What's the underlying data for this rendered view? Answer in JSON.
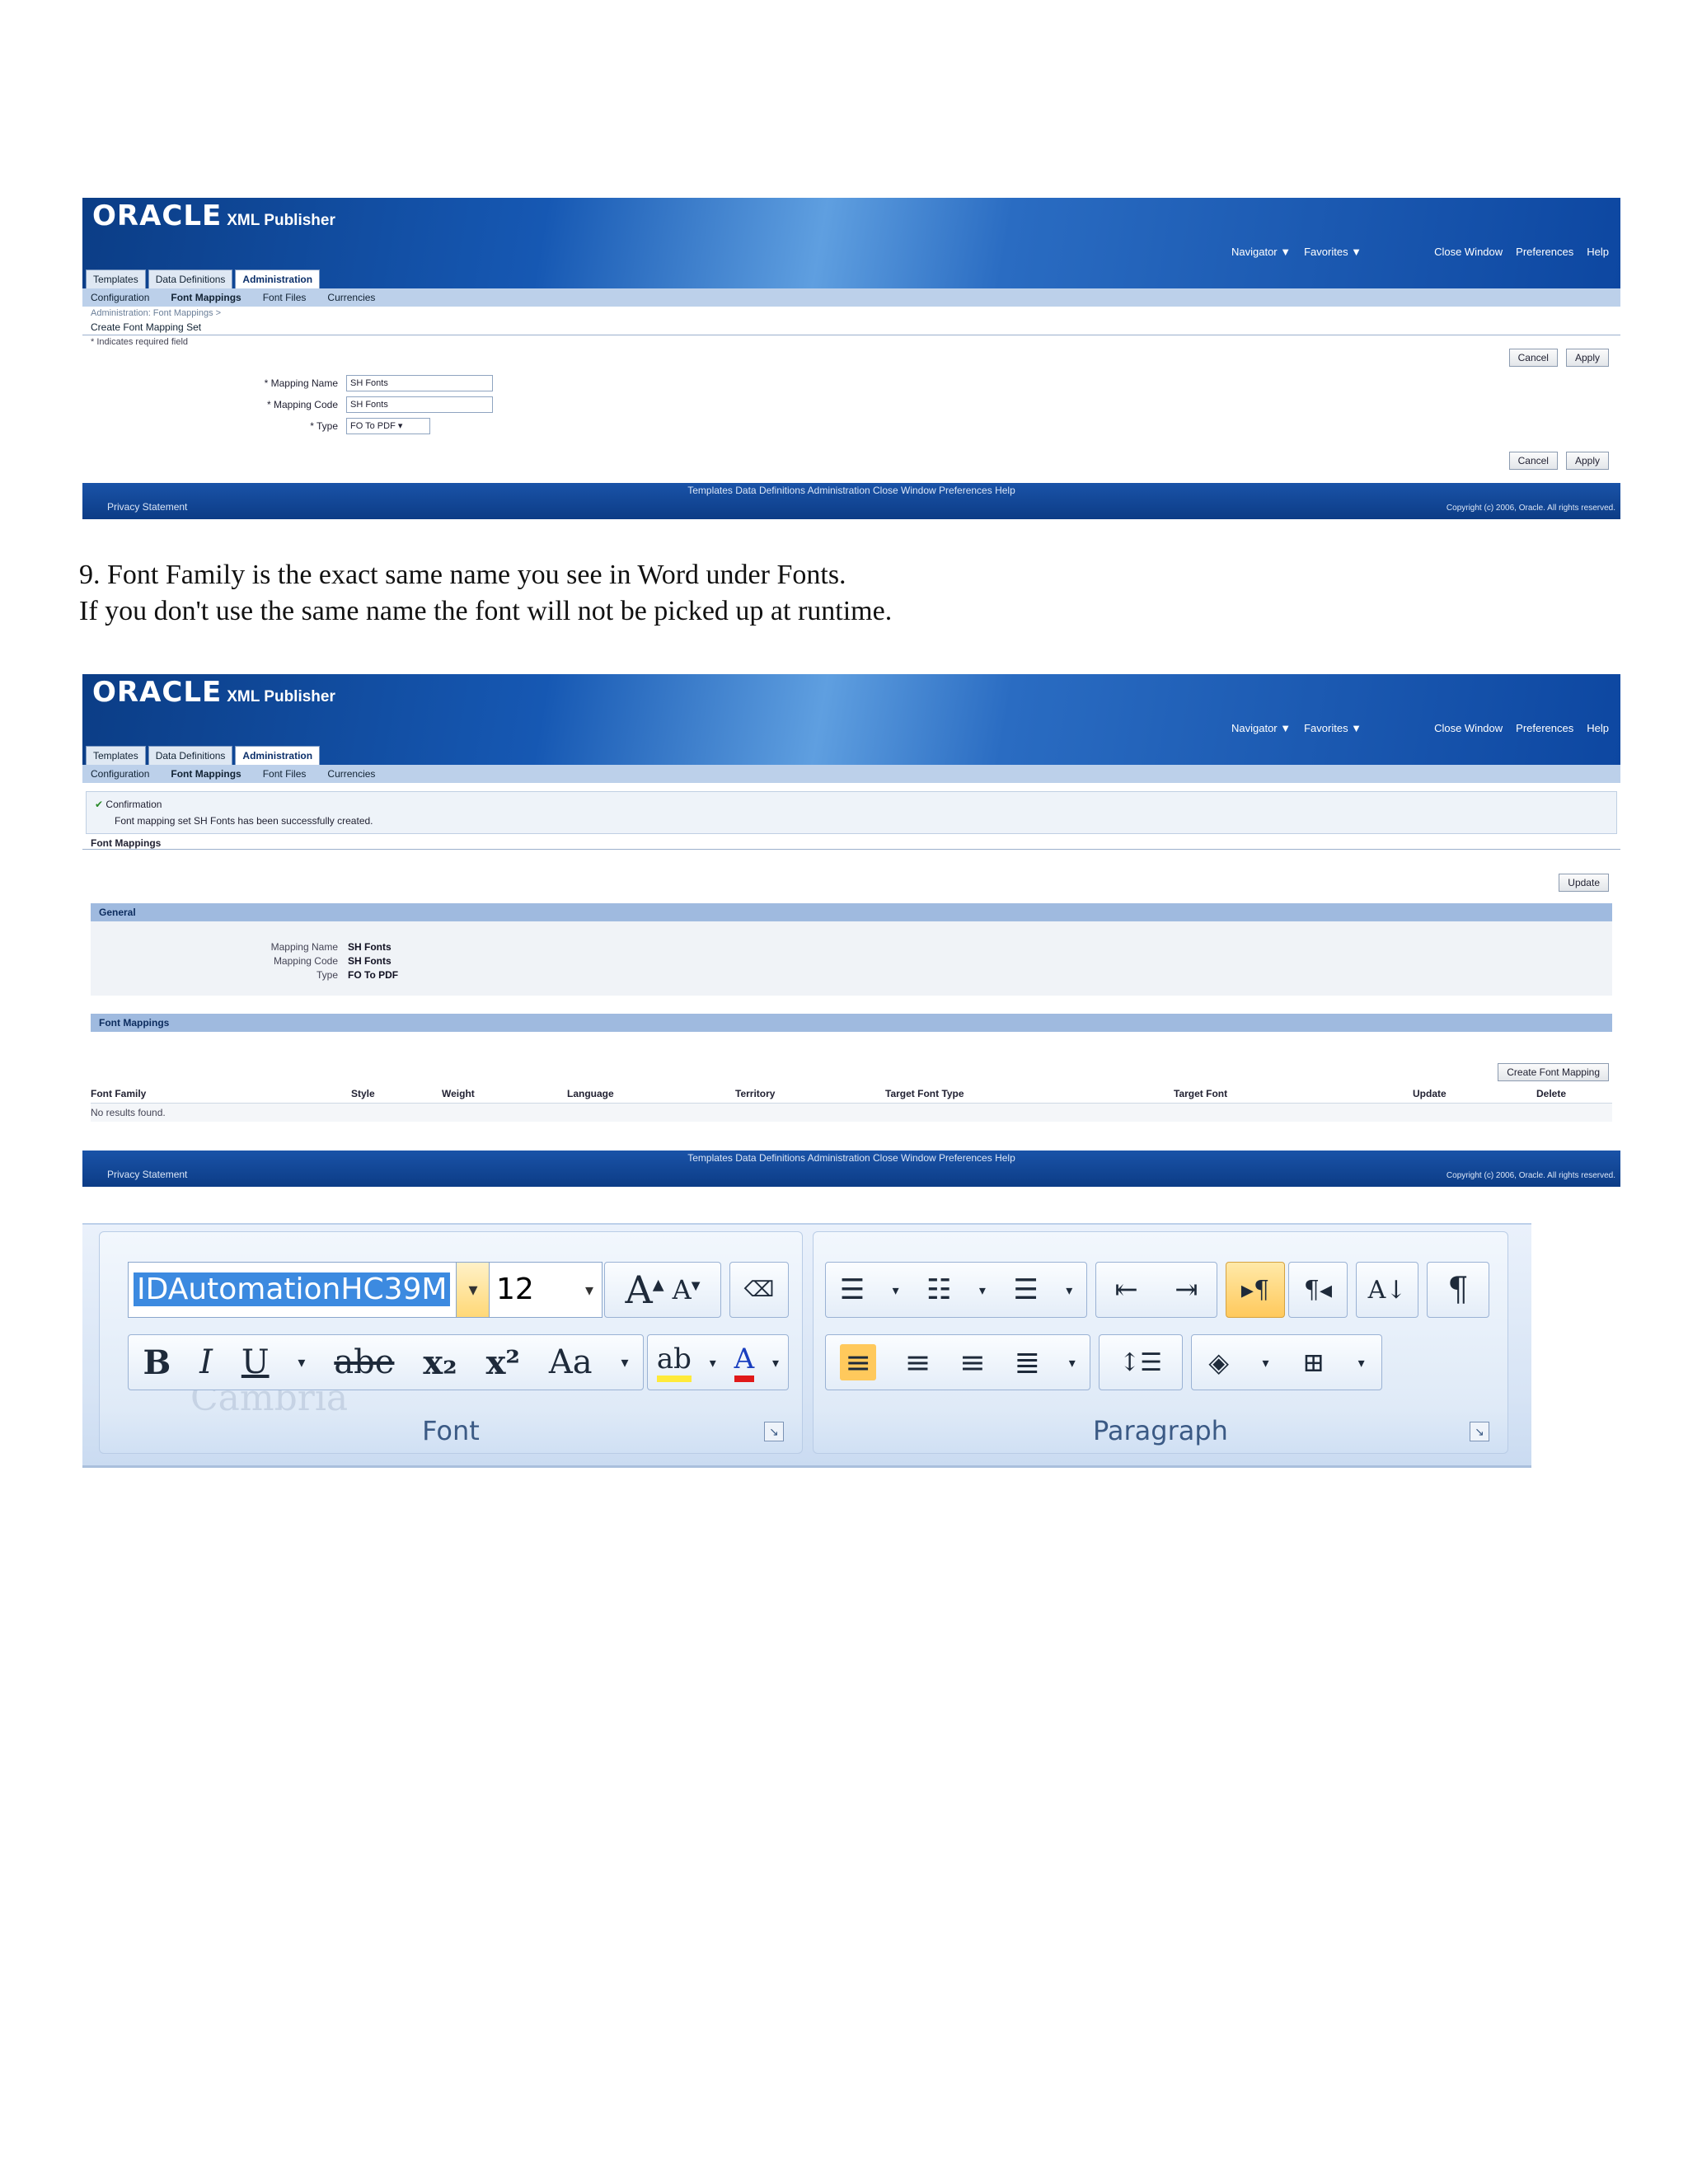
{
  "oracle_common": {
    "brand": "ORACLE",
    "product": "XML Publisher",
    "navigator": "Navigator ▼",
    "favorites": "Favorites ▼",
    "close_window": "Close Window",
    "preferences": "Preferences",
    "help": "Help",
    "tabs": [
      "Templates",
      "Data Definitions",
      "Administration"
    ],
    "subtabs": [
      "Configuration",
      "Font Mappings",
      "Font Files",
      "Currencies"
    ],
    "footer_links": "Templates  Data Definitions  Administration  Close Window  Preferences  Help",
    "privacy": "Privacy Statement",
    "copyright": "Copyright (c) 2006, Oracle. All rights reserved."
  },
  "shot1": {
    "breadcrumb": "Administration: Font Mappings >",
    "page_title": "Create Font Mapping Set",
    "required_note": "* Indicates required field",
    "cancel": "Cancel",
    "apply": "Apply",
    "fields": [
      {
        "label": "* Mapping Name",
        "value": "SH Fonts"
      },
      {
        "label": "* Mapping Code",
        "value": "SH Fonts"
      },
      {
        "label": "* Type",
        "value": "FO To PDF ▾"
      }
    ]
  },
  "instruction": {
    "line1": "9. Font Family  is the exact same name you see in Word under Fonts.",
    "line2": "If you don't use the same name the font will  not be picked up at runtime."
  },
  "shot2": {
    "confirm_title": "Confirmation",
    "confirm_text": "Font mapping set SH Fonts has been successfully created.",
    "section_title": "Font Mappings",
    "update": "Update",
    "general_header": "General",
    "general": [
      {
        "k": "Mapping Name",
        "v": "SH Fonts"
      },
      {
        "k": "Mapping Code",
        "v": "SH Fonts"
      },
      {
        "k": "Type",
        "v": "FO To PDF"
      }
    ],
    "mappings_header": "Font Mappings",
    "create_button": "Create Font Mapping",
    "columns": [
      "Font Family",
      "Style",
      "Weight",
      "Language",
      "Territory",
      "Target Font Type",
      "Target Font",
      "Update",
      "Delete"
    ],
    "no_results": "No results found."
  },
  "ribbon": {
    "font_name": "IDAutomationHC39M",
    "font_size": "12",
    "font_group": "Font",
    "paragraph_group": "Paragraph",
    "bold": "B",
    "italic": "I",
    "underline": "U",
    "strike": "abe",
    "subscript": "x₂",
    "superscript": "x²",
    "change_case": "Aa",
    "grow": "A",
    "shrink": "A",
    "pilcrow": "¶",
    "faint_font": "Cambria",
    "colors": {
      "highlight": "#ffea3a",
      "font_color": "#e01919",
      "hot": "#ffc95c"
    }
  }
}
